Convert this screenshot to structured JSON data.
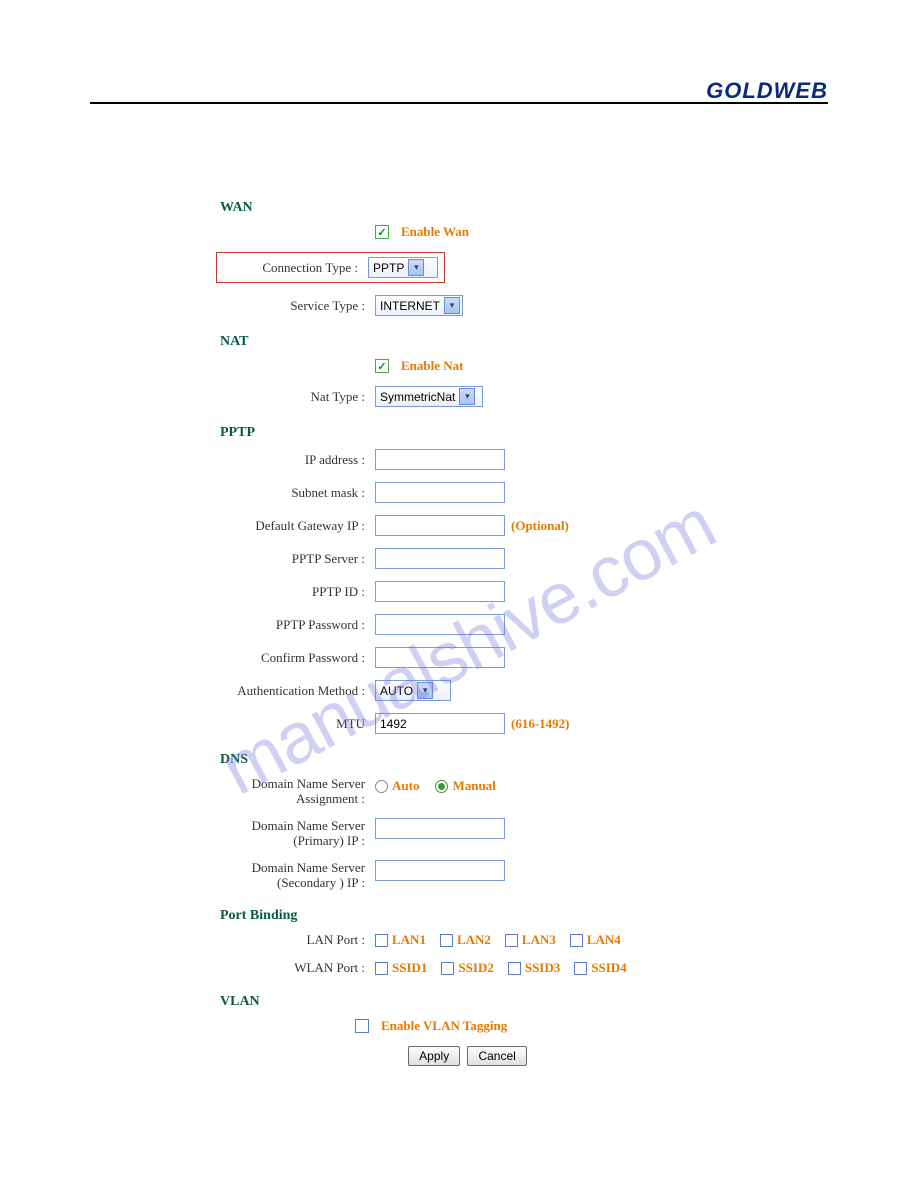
{
  "brand": "GOLDWEB",
  "watermark": "manualshive.com",
  "wan": {
    "title": "WAN",
    "enable_label": "Enable Wan",
    "enable_checked": true,
    "connection_type_label": "Connection Type :",
    "connection_type_value": "PPTP",
    "service_type_label": "Service Type :",
    "service_type_value": "INTERNET"
  },
  "nat": {
    "title": "NAT",
    "enable_label": "Enable Nat",
    "enable_checked": true,
    "nat_type_label": "Nat Type :",
    "nat_type_value": "SymmetricNat"
  },
  "pptp": {
    "title": "PPTP",
    "ip_address_label": "IP address :",
    "ip_address_value": "",
    "subnet_mask_label": "Subnet mask :",
    "subnet_mask_value": "",
    "default_gateway_label": "Default Gateway IP :",
    "default_gateway_value": "",
    "optional_note": "(Optional)",
    "pptp_server_label": "PPTP Server :",
    "pptp_server_value": "",
    "pptp_id_label": "PPTP ID :",
    "pptp_id_value": "",
    "pptp_password_label": "PPTP Password :",
    "pptp_password_value": "",
    "confirm_password_label": "Confirm Password :",
    "confirm_password_value": "",
    "auth_method_label": "Authentication Method :",
    "auth_method_value": "AUTO",
    "mtu_label": "MTU",
    "mtu_value": "1492",
    "mtu_note": "(616-1492)"
  },
  "dns": {
    "title": "DNS",
    "assignment_label_1": "Domain Name Server",
    "assignment_label_2": "Assignment :",
    "auto_label": "Auto",
    "manual_label": "Manual",
    "mode": "Manual",
    "primary_label_1": "Domain Name Server",
    "primary_label_2": "(Primary) IP :",
    "primary_value": "",
    "secondary_label_1": "Domain Name Server",
    "secondary_label_2": "(Secondary ) IP :",
    "secondary_value": ""
  },
  "port_binding": {
    "title": "Port Binding",
    "lan_port_label": "LAN Port :",
    "lan_ports": [
      "LAN1",
      "LAN2",
      "LAN3",
      "LAN4"
    ],
    "wlan_port_label": "WLAN Port :",
    "wlan_ports": [
      "SSID1",
      "SSID2",
      "SSID3",
      "SSID4"
    ]
  },
  "vlan": {
    "title": "VLAN",
    "enable_label": "Enable VLAN Tagging",
    "enable_checked": false
  },
  "actions": {
    "apply": "Apply",
    "cancel": "Cancel"
  }
}
